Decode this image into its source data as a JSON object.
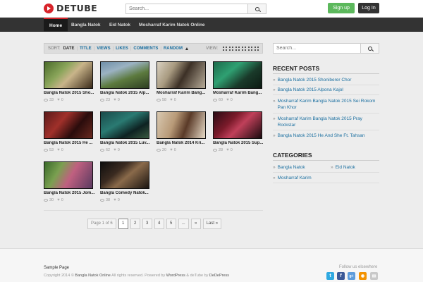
{
  "brand": {
    "name": "DETUBE",
    "accent": "#d8232a"
  },
  "header": {
    "search_placeholder": "Search...",
    "signup_label": "Sign up",
    "login_label": "Log In"
  },
  "nav": {
    "items": [
      "Home",
      "Bangla Natok",
      "Eid Natok",
      "Mosharraf Karim Natok Online"
    ],
    "active": "Home"
  },
  "sortbar": {
    "sort_label": "SORT:",
    "options": [
      "DATE",
      "TITLE",
      "VIEWS",
      "LIKES",
      "COMMENTS",
      "RANDOM"
    ],
    "current": "DATE",
    "view_label": "VIEW:"
  },
  "videos": [
    {
      "title": "Bangla Natok 2015 Sho...",
      "views": "33",
      "likes": "0"
    },
    {
      "title": "Bangla Natok 2015 Alp...",
      "views": "23",
      "likes": "0"
    },
    {
      "title": "Mosharraf Karim Bang...",
      "views": "58",
      "likes": "0"
    },
    {
      "title": "Mosharraf Karim Bang...",
      "views": "60",
      "likes": "0"
    },
    {
      "title": "Bangla Natok 2015 He ...",
      "views": "53",
      "likes": "0"
    },
    {
      "title": "Bangla Natok 2015 Luv...",
      "views": "62",
      "likes": "0"
    },
    {
      "title": "Bangla Natok 2014 Kri...",
      "views": "20",
      "likes": "0"
    },
    {
      "title": "Bangla Natok 2015 Sup...",
      "views": "28",
      "likes": "0"
    },
    {
      "title": "Bangla Natok 2015 Jom...",
      "views": "30",
      "likes": "0"
    },
    {
      "title": "Bangla Comedy Natok...",
      "views": "38",
      "likes": "0"
    }
  ],
  "pagination": {
    "info": "Page 1 of 6",
    "pages": [
      "1",
      "2",
      "3",
      "4",
      "5"
    ],
    "ellipsis": "...",
    "next": "»",
    "last": "Last »"
  },
  "sidebar": {
    "search_placeholder": "Search...",
    "recent_posts_title": "RECENT POSTS",
    "recent_posts": [
      "Bangla Natok 2015 Shoniberer Chor",
      "Bangla Natok 2015 Alpona Kajol",
      "Mosharraf Karim Bangla Natok 2015 Sei Rokom Pan Khor",
      "Mosharraf Karim Bangla Natok 2015 Pray Rockstar",
      "Bangla Natok 2015 He And She Ft. Tahsan"
    ],
    "categories_title": "CATEGORIES",
    "categories": [
      "Bangla Natok",
      "Eid Natok",
      "Mosharraf Karim"
    ]
  },
  "footer": {
    "page_link": "Sample Page",
    "copyright_pre": "Copyright 2014 ©",
    "site_name": "Bangla Natok Online",
    "rights": "All rights reserved. Powered by",
    "wordpress": "WordPress",
    "amp": "& deTube by",
    "dedepress": "DeDePress",
    "follow": "Follow us elsewhere",
    "social": [
      {
        "icon": "twitter-icon",
        "color": "#2fa9e1"
      },
      {
        "icon": "facebook-icon",
        "color": "#3b5998"
      },
      {
        "icon": "google-plus-icon",
        "color": "#5d9cdc"
      },
      {
        "icon": "rss-icon",
        "color": "#f39200"
      },
      {
        "icon": "email-icon",
        "color": "#c9c9c9"
      }
    ]
  }
}
